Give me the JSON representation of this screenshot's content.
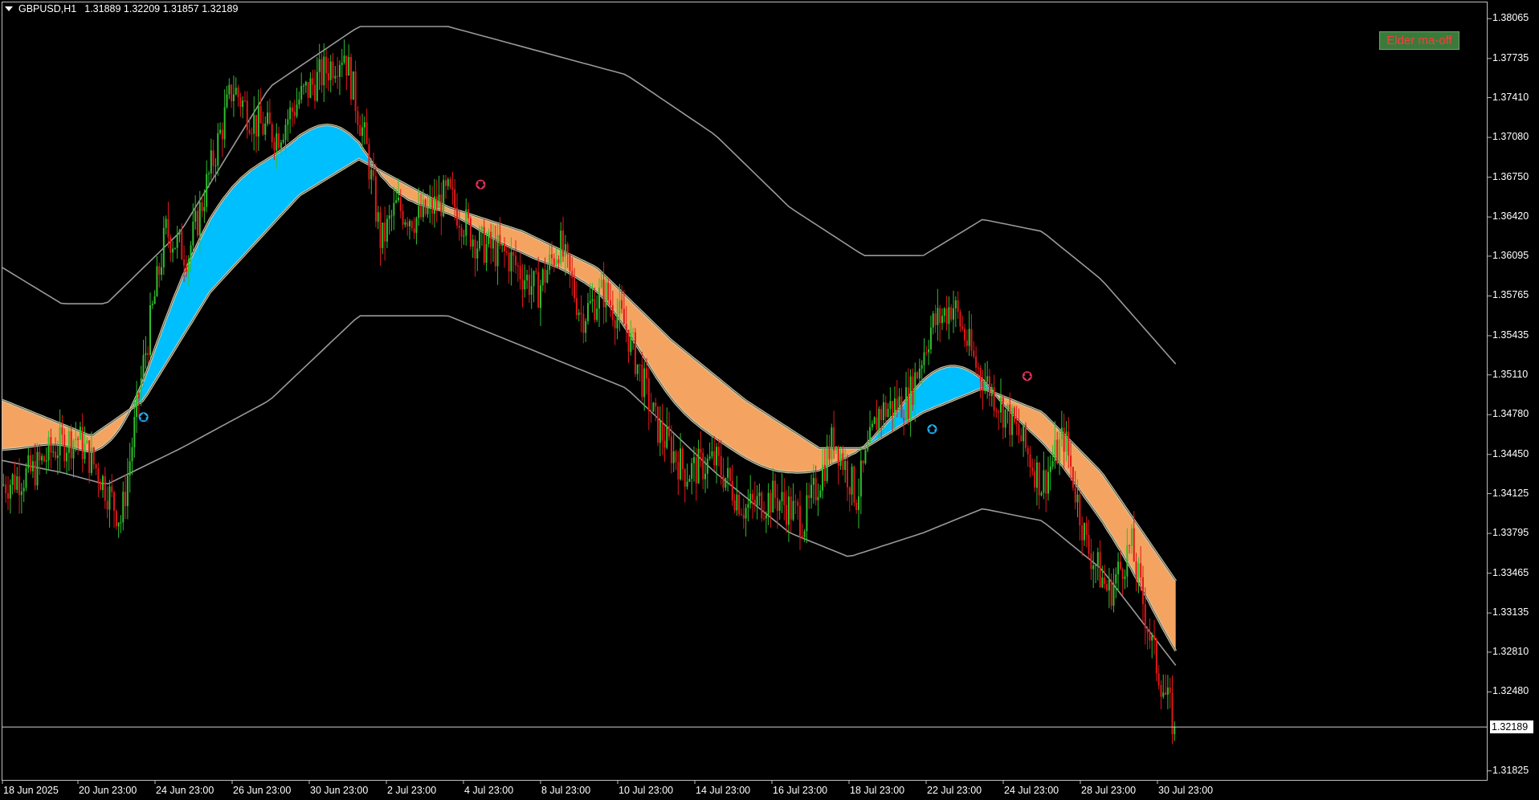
{
  "header": {
    "symbol": "GBPUSD,H1",
    "ohlc": "1.31889 1.32209 1.31857 1.32189"
  },
  "buttons": {
    "elder": "Elder ma-off"
  },
  "price_axis": {
    "labels": [
      "1.38065",
      "1.37735",
      "1.37410",
      "1.37080",
      "1.36750",
      "1.36420",
      "1.36095",
      "1.35765",
      "1.35435",
      "1.35110",
      "1.34780",
      "1.34450",
      "1.34125",
      "1.33795",
      "1.33465",
      "1.33135",
      "1.32810",
      "1.32480",
      "1.31825"
    ],
    "current_price": "1.32189"
  },
  "time_axis": {
    "labels": [
      "18 Jun 2025",
      "20 Jun 23:00",
      "24 Jun 23:00",
      "26 Jun 23:00",
      "30 Jun 23:00",
      "2 Jul 23:00",
      "4 Jul 23:00",
      "8 Jul 23:00",
      "10 Jul 23:00",
      "14 Jul 23:00",
      "16 Jul 23:00",
      "18 Jul 23:00",
      "22 Jul 23:00",
      "24 Jul 23:00",
      "28 Jul 23:00",
      "30 Jul 23:00"
    ]
  },
  "colors": {
    "background": "#000000",
    "bull": "#2fbf2f",
    "bear": "#e01818",
    "cloud_up": "#00bfff",
    "cloud_down": "#f4a460",
    "envelope": "#9a9a9a",
    "arrow_up": "#1ab0ff",
    "arrow_down": "#e8305a",
    "button_bg": "#3b7a3b",
    "button_text": "#ff3b3b"
  },
  "chart_data": {
    "type": "candlestick",
    "symbol": "GBPUSD",
    "timeframe": "H1",
    "ylim": [
      1.3175,
      1.382
    ],
    "last_price": 1.32189,
    "close_path": [
      [
        0,
        1.342
      ],
      [
        0.02,
        1.343
      ],
      [
        0.035,
        1.345
      ],
      [
        0.05,
        1.346
      ],
      [
        0.065,
        1.343
      ],
      [
        0.08,
        1.339
      ],
      [
        0.095,
        1.352
      ],
      [
        0.11,
        1.363
      ],
      [
        0.125,
        1.361
      ],
      [
        0.14,
        1.368
      ],
      [
        0.155,
        1.375
      ],
      [
        0.17,
        1.372
      ],
      [
        0.185,
        1.371
      ],
      [
        0.2,
        1.374
      ],
      [
        0.215,
        1.376
      ],
      [
        0.23,
        1.378
      ],
      [
        0.245,
        1.37
      ],
      [
        0.255,
        1.362
      ],
      [
        0.265,
        1.365
      ],
      [
        0.28,
        1.364
      ],
      [
        0.3,
        1.366
      ],
      [
        0.32,
        1.362
      ],
      [
        0.34,
        1.361
      ],
      [
        0.36,
        1.358
      ],
      [
        0.375,
        1.362
      ],
      [
        0.39,
        1.356
      ],
      [
        0.405,
        1.358
      ],
      [
        0.42,
        1.355
      ],
      [
        0.44,
        1.347
      ],
      [
        0.46,
        1.343
      ],
      [
        0.48,
        1.344
      ],
      [
        0.5,
        1.34
      ],
      [
        0.52,
        1.341
      ],
      [
        0.54,
        1.339
      ],
      [
        0.56,
        1.346
      ],
      [
        0.575,
        1.341
      ],
      [
        0.59,
        1.348
      ],
      [
        0.61,
        1.349
      ],
      [
        0.625,
        1.355
      ],
      [
        0.64,
        1.357
      ],
      [
        0.655,
        1.352
      ],
      [
        0.67,
        1.349
      ],
      [
        0.685,
        1.346
      ],
      [
        0.7,
        1.342
      ],
      [
        0.715,
        1.346
      ],
      [
        0.73,
        1.337
      ],
      [
        0.745,
        1.333
      ],
      [
        0.76,
        1.337
      ],
      [
        0.775,
        1.328
      ],
      [
        0.79,
        1.3215
      ]
    ],
    "mid_line_path": [
      [
        0,
        1.349
      ],
      [
        0.06,
        1.346
      ],
      [
        0.095,
        1.349
      ],
      [
        0.14,
        1.358
      ],
      [
        0.2,
        1.366
      ],
      [
        0.24,
        1.369
      ],
      [
        0.3,
        1.365
      ],
      [
        0.35,
        1.363
      ],
      [
        0.4,
        1.36
      ],
      [
        0.45,
        1.354
      ],
      [
        0.5,
        1.349
      ],
      [
        0.55,
        1.345
      ],
      [
        0.58,
        1.345
      ],
      [
        0.62,
        1.348
      ],
      [
        0.66,
        1.35
      ],
      [
        0.7,
        1.348
      ],
      [
        0.74,
        1.343
      ],
      [
        0.79,
        1.334
      ]
    ],
    "envelope_upper": [
      [
        0,
        1.36
      ],
      [
        0.04,
        1.357
      ],
      [
        0.07,
        1.357
      ],
      [
        0.12,
        1.363
      ],
      [
        0.18,
        1.375
      ],
      [
        0.24,
        1.38
      ],
      [
        0.3,
        1.38
      ],
      [
        0.36,
        1.378
      ],
      [
        0.42,
        1.376
      ],
      [
        0.48,
        1.371
      ],
      [
        0.53,
        1.365
      ],
      [
        0.58,
        1.361
      ],
      [
        0.62,
        1.361
      ],
      [
        0.66,
        1.364
      ],
      [
        0.7,
        1.363
      ],
      [
        0.74,
        1.359
      ],
      [
        0.79,
        1.352
      ]
    ],
    "envelope_lower": [
      [
        0,
        1.344
      ],
      [
        0.04,
        1.343
      ],
      [
        0.07,
        1.342
      ],
      [
        0.12,
        1.345
      ],
      [
        0.18,
        1.349
      ],
      [
        0.24,
        1.356
      ],
      [
        0.3,
        1.356
      ],
      [
        0.36,
        1.353
      ],
      [
        0.42,
        1.35
      ],
      [
        0.48,
        1.343
      ],
      [
        0.53,
        1.338
      ],
      [
        0.57,
        1.336
      ],
      [
        0.62,
        1.338
      ],
      [
        0.66,
        1.34
      ],
      [
        0.7,
        1.339
      ],
      [
        0.74,
        1.335
      ],
      [
        0.79,
        1.327
      ]
    ],
    "signals": [
      {
        "type": "buy",
        "x": 0.095,
        "price": 1.3476
      },
      {
        "type": "sell",
        "x": 0.322,
        "price": 1.3669
      },
      {
        "type": "buy",
        "x": 0.626,
        "price": 1.3466
      },
      {
        "type": "sell",
        "x": 0.69,
        "price": 1.351
      }
    ]
  }
}
